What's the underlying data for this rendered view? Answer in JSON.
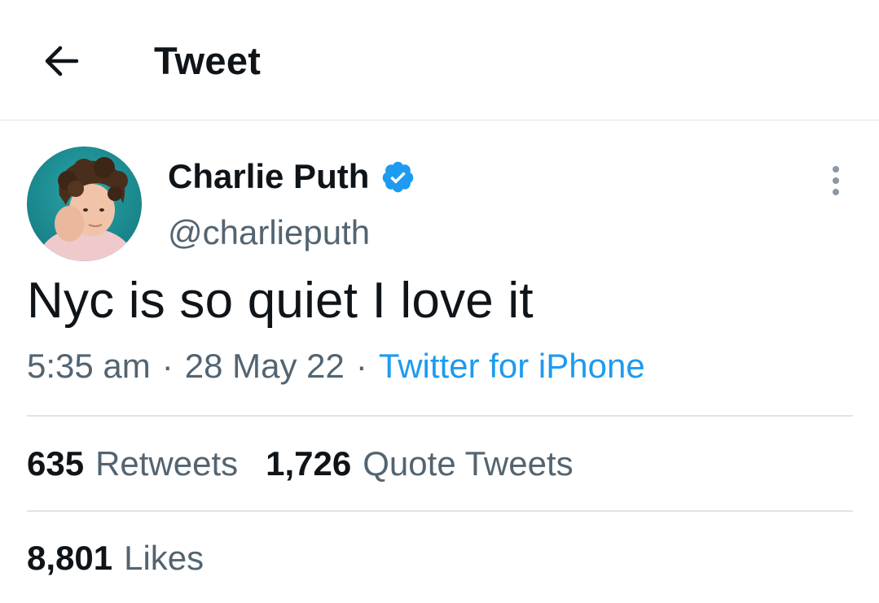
{
  "header": {
    "back_icon": "arrow-left-icon",
    "title": "Tweet"
  },
  "tweet": {
    "author": {
      "display_name": "Charlie Puth",
      "handle": "@charlieputh",
      "verified_icon": "verified-badge-icon"
    },
    "more_icon": "more-vertical-icon",
    "text": "Nyc is so quiet I love it",
    "time": "5:35 am",
    "separator": "·",
    "date": "28 May 22",
    "source": "Twitter for iPhone"
  },
  "stats": {
    "retweets": {
      "count": "635",
      "label": "Retweets"
    },
    "quote_tweets": {
      "count": "1,726",
      "label": "Quote Tweets"
    },
    "likes": {
      "count": "8,801",
      "label": "Likes"
    }
  },
  "colors": {
    "text_primary": "#0f1419",
    "text_secondary": "#536471",
    "accent": "#1d9bf0",
    "divider": "#e1e4e7",
    "background": "#ffffff"
  }
}
